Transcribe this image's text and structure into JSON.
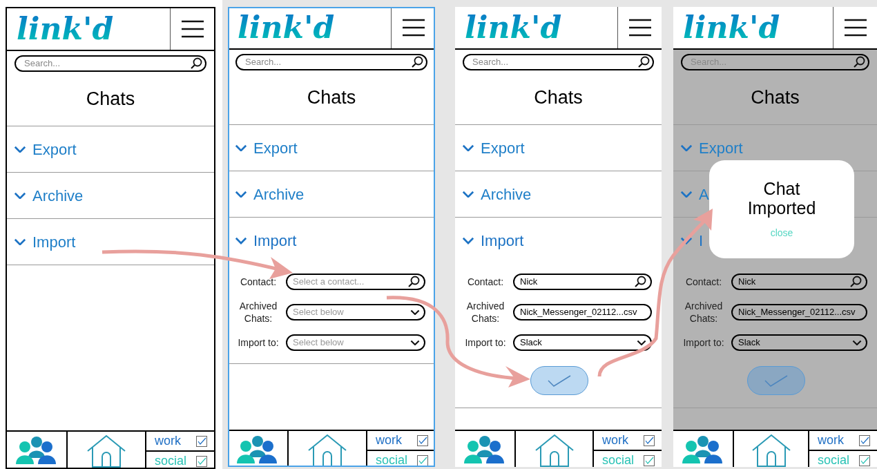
{
  "frames": [
    {
      "outlined": true,
      "selected": false,
      "dimmed": false,
      "logo": "link'd",
      "search": {
        "placeholder": "Search..."
      },
      "title": "Chats",
      "sections": [
        {
          "label": "Export",
          "expanded": false
        },
        {
          "label": "Archive",
          "expanded": false
        },
        {
          "label": "Import",
          "expanded": false
        }
      ],
      "nav": {
        "work": {
          "label": "work",
          "checked": true
        },
        "social": {
          "label": "social",
          "checked": true
        }
      }
    },
    {
      "outlined": false,
      "selected": true,
      "dimmed": false,
      "logo": "link'd",
      "search": {
        "placeholder": "Search..."
      },
      "title": "Chats",
      "sections": [
        {
          "label": "Export",
          "expanded": false
        },
        {
          "label": "Archive",
          "expanded": false
        },
        {
          "label": "Import",
          "expanded": true
        }
      ],
      "form": [
        {
          "kind": "search",
          "label": "Contact:",
          "placeholder": "Select a contact..."
        },
        {
          "kind": "select",
          "label": "Archived Chats:",
          "placeholder": "Select below"
        },
        {
          "kind": "select",
          "label": "Import to:",
          "placeholder": "Select below"
        }
      ],
      "nav": {
        "work": {
          "label": "work",
          "checked": true
        },
        "social": {
          "label": "social",
          "checked": true
        }
      }
    },
    {
      "outlined": false,
      "selected": false,
      "dimmed": false,
      "logo": "link'd",
      "search": {
        "placeholder": "Search..."
      },
      "title": "Chats",
      "sections": [
        {
          "label": "Export",
          "expanded": false
        },
        {
          "label": "Archive",
          "expanded": false
        },
        {
          "label": "Import",
          "expanded": true
        }
      ],
      "form": [
        {
          "kind": "search",
          "label": "Contact:",
          "value": "Nick"
        },
        {
          "kind": "text",
          "label": "Archived Chats:",
          "value": "Nick_Messenger_02112...csv"
        },
        {
          "kind": "select",
          "label": "Import to:",
          "value": "Slack"
        }
      ],
      "confirm": true,
      "nav": {
        "work": {
          "label": "work",
          "checked": true
        },
        "social": {
          "label": "social",
          "checked": true
        }
      }
    },
    {
      "outlined": false,
      "selected": false,
      "dimmed": true,
      "logo": "link'd",
      "search": {
        "placeholder": "Search..."
      },
      "title": "Chats",
      "sections": [
        {
          "label": "Export",
          "expanded": false
        },
        {
          "label": "A",
          "expanded": false
        },
        {
          "label": "I",
          "expanded": true
        }
      ],
      "form": [
        {
          "kind": "search",
          "label": "Contact:",
          "value": "Nick"
        },
        {
          "kind": "text",
          "label": "Archived Chats:",
          "value": "Nick_Messenger_02112...csv"
        },
        {
          "kind": "select",
          "label": "Import to:",
          "value": "Slack"
        }
      ],
      "confirm": true,
      "modal": {
        "title": "Chat Imported",
        "action": "close"
      },
      "nav": {
        "work": {
          "label": "work",
          "checked": true
        },
        "social": {
          "label": "social",
          "checked": true
        }
      }
    }
  ]
}
